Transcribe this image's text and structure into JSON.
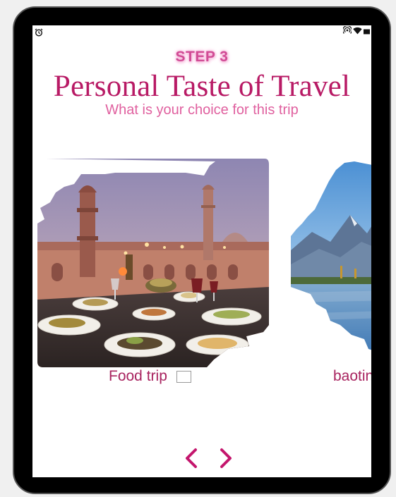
{
  "step": {
    "label": "STEP 3"
  },
  "header": {
    "title": "Personal Taste of Travel",
    "subtitle": "What is your choice for this trip"
  },
  "cards": [
    {
      "label": "Food trip",
      "checked": false,
      "image": "food-table-photo"
    },
    {
      "label": "baoting",
      "checked": false,
      "image": "lake-mountain-photo"
    }
  ],
  "navigation": {
    "prev_icon": "chevron-left-icon",
    "next_icon": "chevron-right-icon"
  },
  "colors": {
    "accent": "#b81a65",
    "subtitle": "#e0609f",
    "step": "#d14b95",
    "nav": "#c4166d"
  },
  "status_icons": [
    "alarm-icon",
    "hotspot-icon",
    "wifi-icon",
    "battery-icon"
  ]
}
